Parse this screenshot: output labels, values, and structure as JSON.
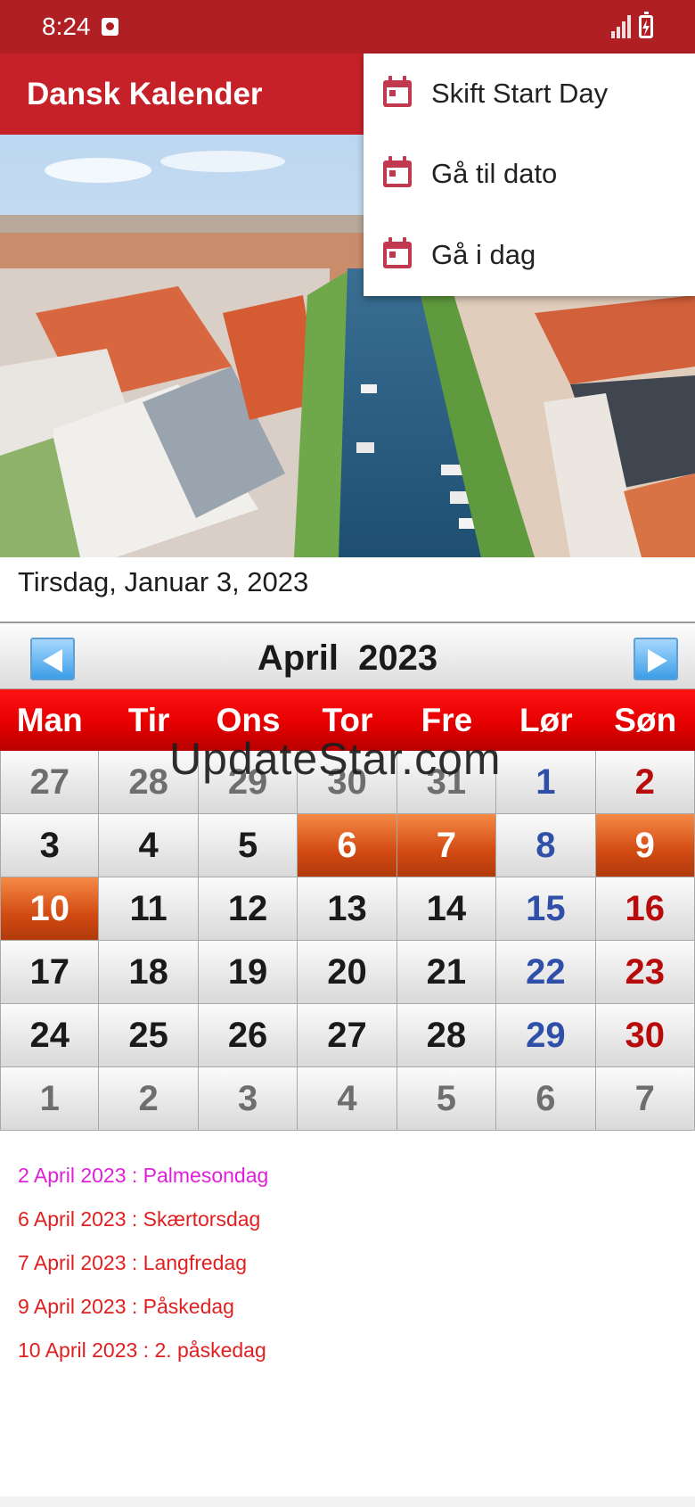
{
  "status_bar": {
    "time": "8:24"
  },
  "app_bar": {
    "title": "Dansk Kalender"
  },
  "menu": {
    "items": [
      {
        "label": "Skift Start Day",
        "icon": "calendar-icon"
      },
      {
        "label": "Gå til dato",
        "icon": "calendar-icon"
      },
      {
        "label": "Gå i dag",
        "icon": "calendar-icon"
      }
    ]
  },
  "current_date": "Tirsdag, Januar 3, 2023",
  "calendar": {
    "month_label": "April  2023",
    "weekdays": [
      "Man",
      "Tir",
      "Ons",
      "Tor",
      "Fre",
      "Lør",
      "Søn"
    ],
    "days": [
      {
        "d": "27",
        "type": "other"
      },
      {
        "d": "28",
        "type": "other"
      },
      {
        "d": "29",
        "type": "other"
      },
      {
        "d": "30",
        "type": "other"
      },
      {
        "d": "31",
        "type": "other"
      },
      {
        "d": "1",
        "type": "sat"
      },
      {
        "d": "2",
        "type": "sun"
      },
      {
        "d": "3",
        "type": ""
      },
      {
        "d": "4",
        "type": ""
      },
      {
        "d": "5",
        "type": ""
      },
      {
        "d": "6",
        "type": "holiday"
      },
      {
        "d": "7",
        "type": "holiday"
      },
      {
        "d": "8",
        "type": "sat"
      },
      {
        "d": "9",
        "type": "holiday"
      },
      {
        "d": "10",
        "type": "holiday"
      },
      {
        "d": "11",
        "type": ""
      },
      {
        "d": "12",
        "type": ""
      },
      {
        "d": "13",
        "type": ""
      },
      {
        "d": "14",
        "type": ""
      },
      {
        "d": "15",
        "type": "sat"
      },
      {
        "d": "16",
        "type": "sun"
      },
      {
        "d": "17",
        "type": ""
      },
      {
        "d": "18",
        "type": ""
      },
      {
        "d": "19",
        "type": ""
      },
      {
        "d": "20",
        "type": ""
      },
      {
        "d": "21",
        "type": ""
      },
      {
        "d": "22",
        "type": "sat"
      },
      {
        "d": "23",
        "type": "sun"
      },
      {
        "d": "24",
        "type": ""
      },
      {
        "d": "25",
        "type": ""
      },
      {
        "d": "26",
        "type": ""
      },
      {
        "d": "27",
        "type": ""
      },
      {
        "d": "28",
        "type": ""
      },
      {
        "d": "29",
        "type": "sat"
      },
      {
        "d": "30",
        "type": "sun"
      },
      {
        "d": "1",
        "type": "other"
      },
      {
        "d": "2",
        "type": "other"
      },
      {
        "d": "3",
        "type": "other"
      },
      {
        "d": "4",
        "type": "other"
      },
      {
        "d": "5",
        "type": "other"
      },
      {
        "d": "6",
        "type": "other"
      },
      {
        "d": "7",
        "type": "other"
      }
    ]
  },
  "watermark": "UpdateStar.com",
  "holidays": [
    {
      "text": "2 April 2023 : Palmesondag",
      "color": "#e020d8"
    },
    {
      "text": "6 April 2023 : Skærtorsdag",
      "color": "#e02020"
    },
    {
      "text": "7 April 2023 : Langfredag",
      "color": "#e02020"
    },
    {
      "text": "9 April 2023 : Påskedag",
      "color": "#e02020"
    },
    {
      "text": "10 April 2023 : 2. påskedag",
      "color": "#e02020"
    }
  ],
  "colors": {
    "status_bar": "#b01f24",
    "app_bar": "#c62128",
    "holiday_cell": "#e0621f",
    "saturday": "#2f4fa8",
    "sunday": "#b80c0c"
  }
}
